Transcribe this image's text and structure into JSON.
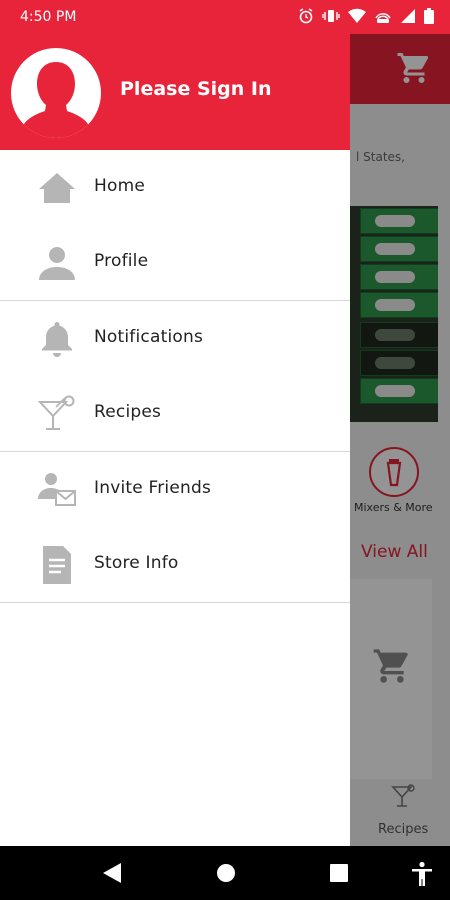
{
  "status_bar": {
    "time": "4:50 PM",
    "icons": [
      "alarm-icon",
      "vibrate-icon",
      "wifi-icon",
      "hotspot-icon",
      "signal-icon",
      "battery-icon"
    ]
  },
  "background_app": {
    "location_snippet": "l States,",
    "category_label": "Mixers & More",
    "view_all_label": "View All",
    "bottom_tab_label": "Recipes"
  },
  "drawer": {
    "sign_in_label": "Please Sign In",
    "groups": [
      [
        {
          "label": "Home",
          "icon": "home-icon"
        },
        {
          "label": "Profile",
          "icon": "profile-icon"
        }
      ],
      [
        {
          "label": "Notifications",
          "icon": "bell-icon"
        },
        {
          "label": "Recipes",
          "icon": "cocktail-icon"
        }
      ],
      [
        {
          "label": "Invite Friends",
          "icon": "invite-icon"
        },
        {
          "label": "Store Info",
          "icon": "document-icon"
        }
      ]
    ]
  },
  "colors": {
    "brand": "#e8243a",
    "icon_gray": "#b5b5b5"
  },
  "nav_bar": {
    "buttons": [
      "back-icon",
      "home-circle-icon",
      "recents-icon",
      "accessibility-icon"
    ]
  }
}
